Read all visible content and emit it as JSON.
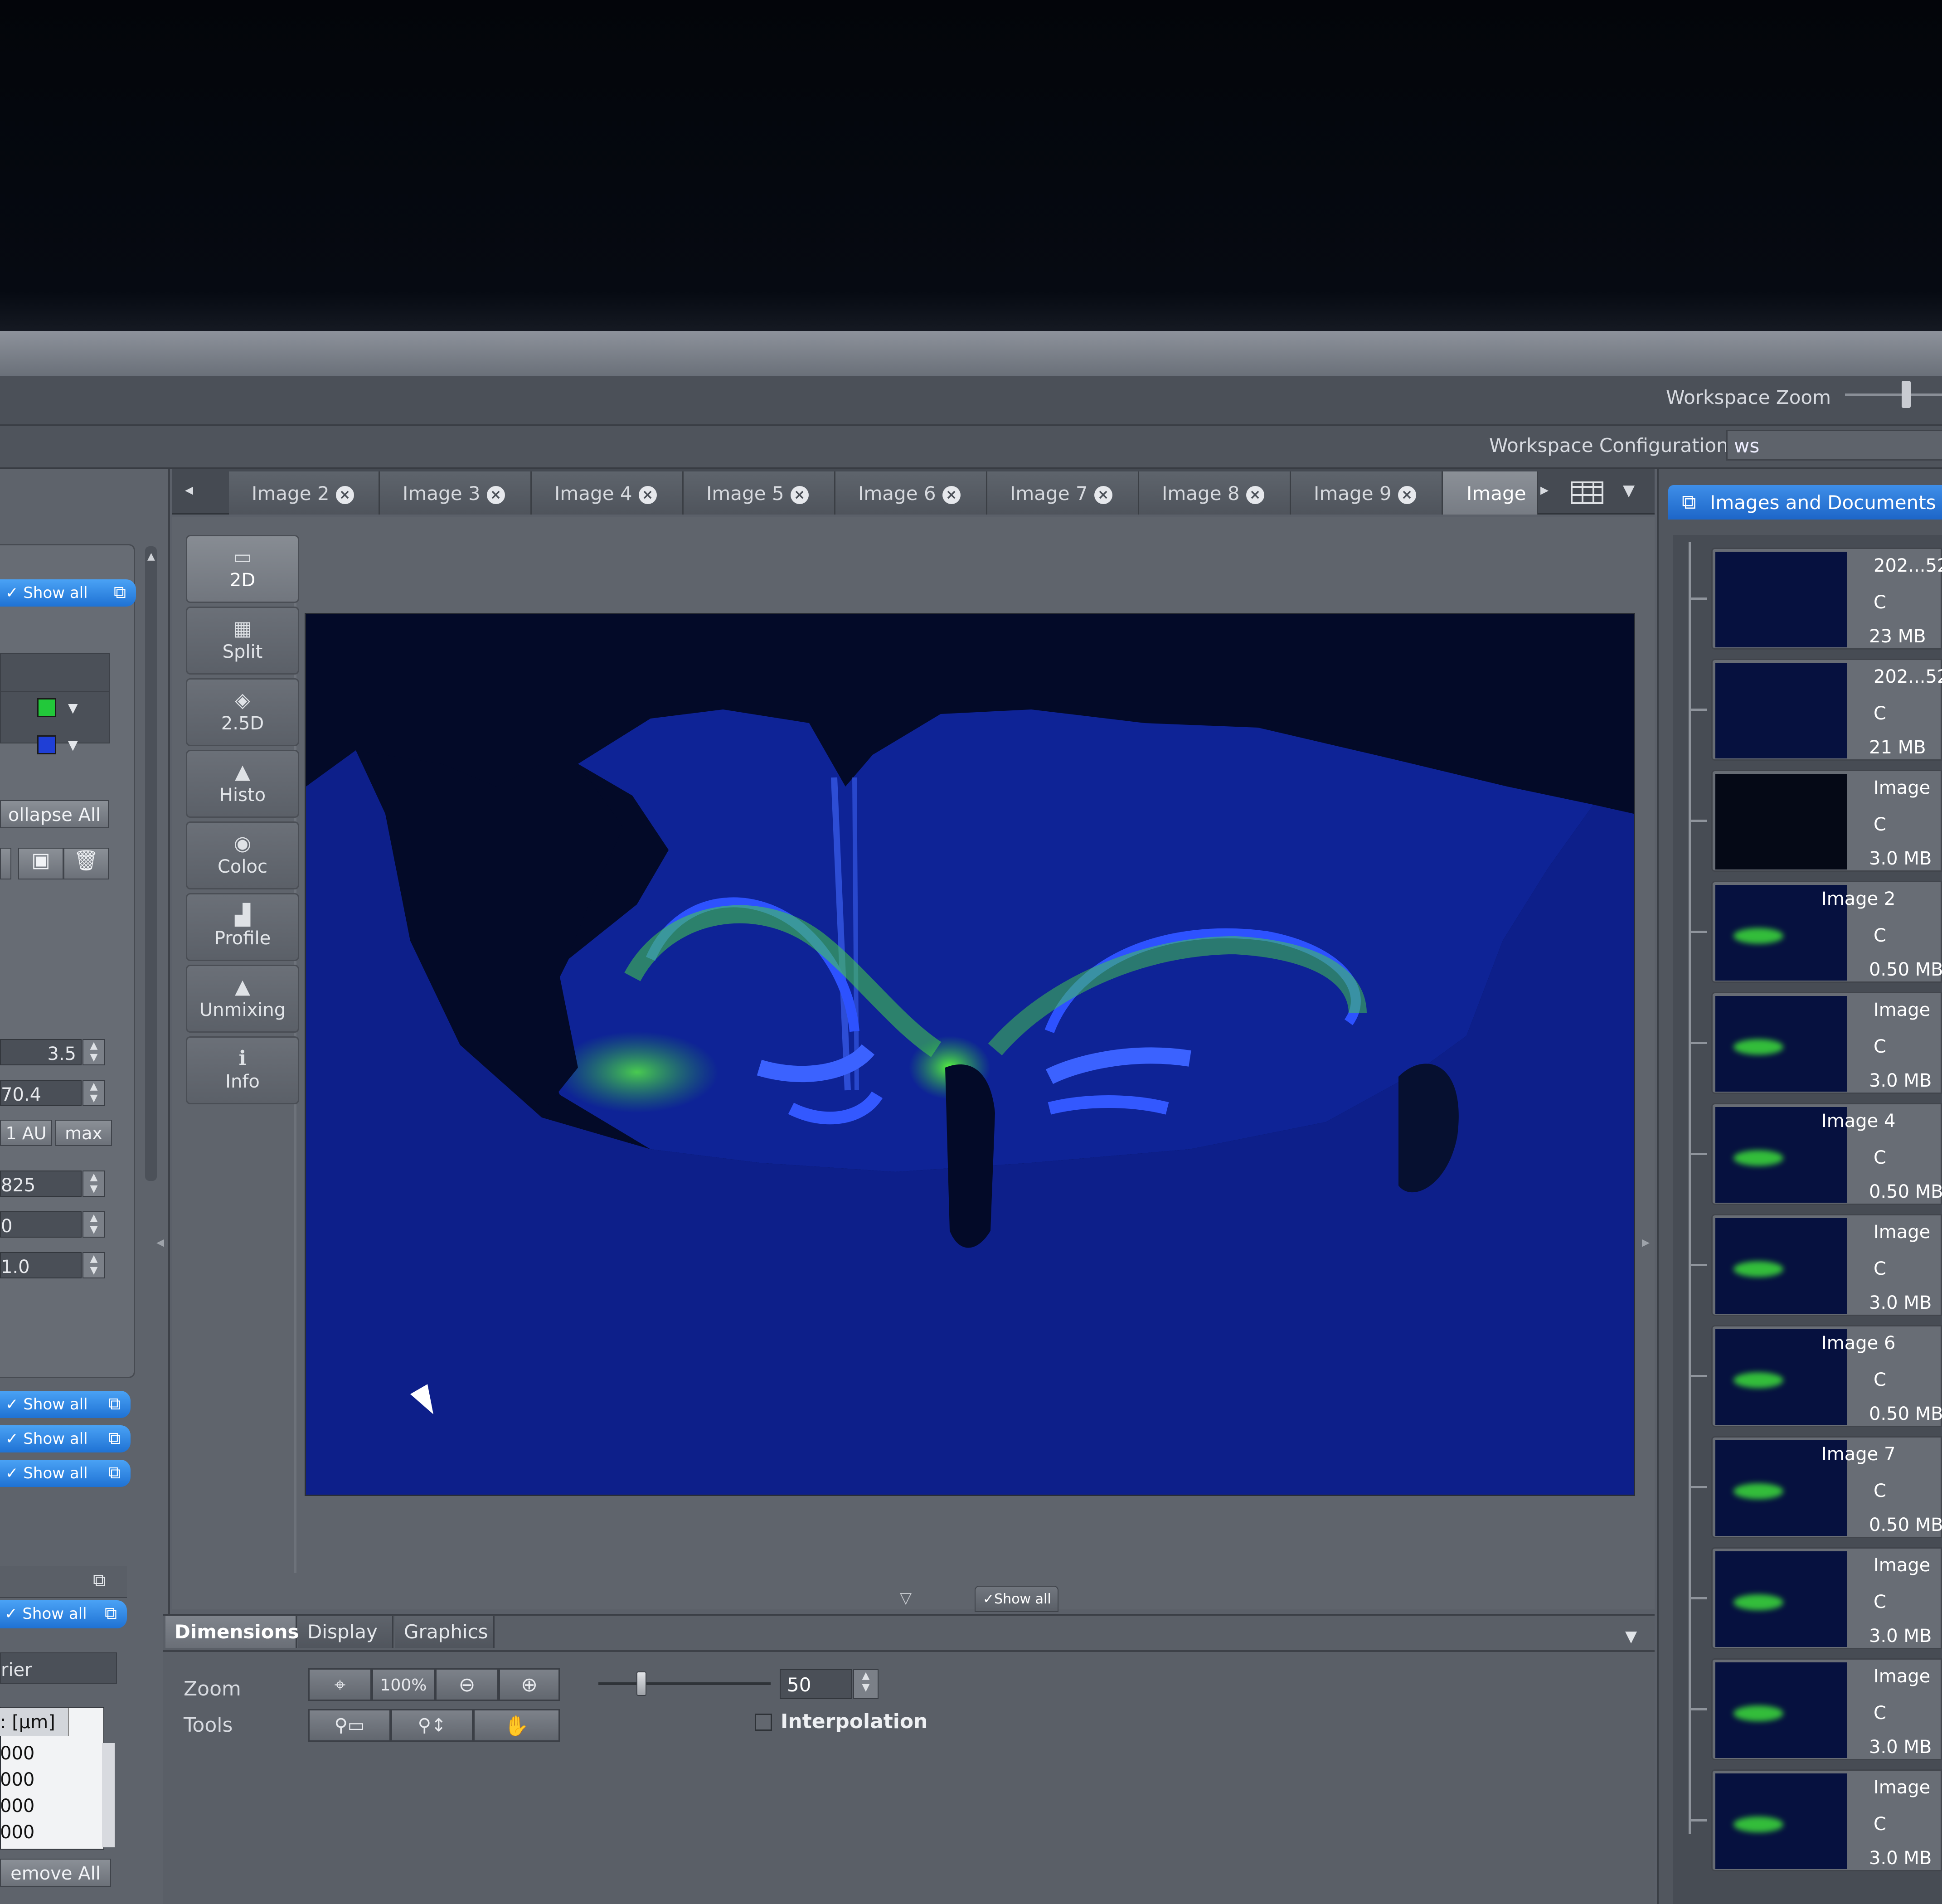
{
  "workspace": {
    "zoom_label": "Workspace Zoom",
    "config_label": "Workspace Configuration",
    "config_value": "ws"
  },
  "tabs": [
    {
      "label": "Image 2"
    },
    {
      "label": "Image 3"
    },
    {
      "label": "Image 4"
    },
    {
      "label": "Image 5"
    },
    {
      "label": "Image 6"
    },
    {
      "label": "Image 7"
    },
    {
      "label": "Image 8"
    },
    {
      "label": "Image 9"
    },
    {
      "label": "Image"
    }
  ],
  "view_tools": [
    {
      "label": "2D",
      "icon": "2d-view-icon"
    },
    {
      "label": "Split",
      "icon": "split-view-icon"
    },
    {
      "label": "2.5D",
      "icon": "2-5d-view-icon"
    },
    {
      "label": "Histo",
      "icon": "histogram-icon"
    },
    {
      "label": "Coloc",
      "icon": "colocalization-icon"
    },
    {
      "label": "Profile",
      "icon": "profile-icon"
    },
    {
      "label": "Unmixing",
      "icon": "unmixing-icon"
    },
    {
      "label": "Info",
      "icon": "info-icon"
    }
  ],
  "left": {
    "show_all": "Show all",
    "collapse_all": "ollapse All",
    "val_35": "3.5",
    "val_704": "70.4",
    "au": "1 AU",
    "max": "max",
    "val_825": "825",
    "val_0": "0",
    "val_10": "1.0",
    "header_tail": "rier",
    "col_header": ": [µm]",
    "list_vals": [
      "000",
      "000",
      "000",
      "000"
    ],
    "remove_all": "emove All",
    "colors": {
      "green": "#22c83a",
      "blue": "#1f3fd6"
    }
  },
  "image_overlay": {
    "show_all": "Show all"
  },
  "bottom": {
    "tabs": [
      "Dimensions",
      "Display",
      "Graphics"
    ],
    "zoom_label": "Zoom",
    "tools_label": "Tools",
    "zoom_100": "100%",
    "zoom_value": "50",
    "interpolation": "Interpolation",
    "zoom_slider_fraction": 0.25
  },
  "right": {
    "header": "Images and Documents",
    "items": [
      {
        "name": "202...52",
        "ch": "C",
        "size": "23 MB"
      },
      {
        "name": "202...52",
        "ch": "C",
        "size": "21 MB"
      },
      {
        "name": "Image",
        "ch": "C",
        "size": "3.0 MB"
      },
      {
        "name": "Image 2",
        "ch": "C",
        "size": "0.50 MB"
      },
      {
        "name": "Image",
        "ch": "C",
        "size": "3.0 MB"
      },
      {
        "name": "Image 4",
        "ch": "C",
        "size": "0.50 MB"
      },
      {
        "name": "Image",
        "ch": "C",
        "size": "3.0 MB"
      },
      {
        "name": "Image 6",
        "ch": "C",
        "size": "0.50 MB"
      },
      {
        "name": "Image 7",
        "ch": "C",
        "size": "0.50 MB"
      },
      {
        "name": "Image",
        "ch": "C",
        "size": "3.0 MB"
      },
      {
        "name": "Image",
        "ch": "C",
        "size": "3.0 MB"
      },
      {
        "name": "Image",
        "ch": "C",
        "size": "3.0 MB"
      }
    ]
  }
}
